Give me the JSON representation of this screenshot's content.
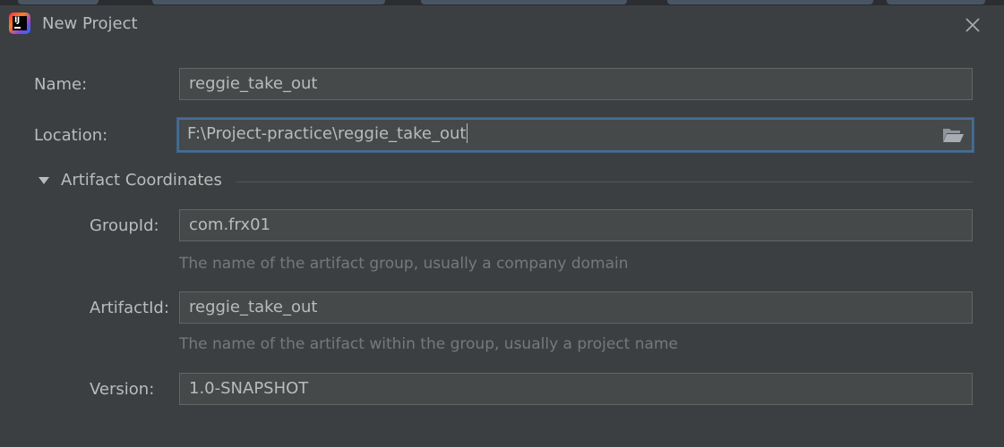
{
  "dialog": {
    "title": "New Project",
    "close_icon": "close-icon",
    "app_icon": "intellij-idea-icon"
  },
  "form": {
    "name": {
      "label": "Name:",
      "value": "reggie_take_out"
    },
    "location": {
      "label": "Location:",
      "value": "F:\\Project-practice\\reggie_take_out",
      "browse_icon": "folder-open-icon"
    }
  },
  "artifact": {
    "section_title": "Artifact Coordinates",
    "toggle_icon": "triangle-down-icon",
    "group_id": {
      "label": "GroupId:",
      "value": "com.frx01",
      "hint": "The name of the artifact group, usually a company domain"
    },
    "artifact_id": {
      "label": "ArtifactId:",
      "value": "reggie_take_out",
      "hint": "The name of the artifact within the group, usually a project name"
    },
    "version": {
      "label": "Version:",
      "value": "1.0-SNAPSHOT"
    }
  },
  "colors": {
    "background": "#3c3f41",
    "field_background": "#45494a",
    "field_border": "#646464",
    "focus_border": "#466d94",
    "text": "#bbbbbb",
    "hint_text": "#787878"
  }
}
